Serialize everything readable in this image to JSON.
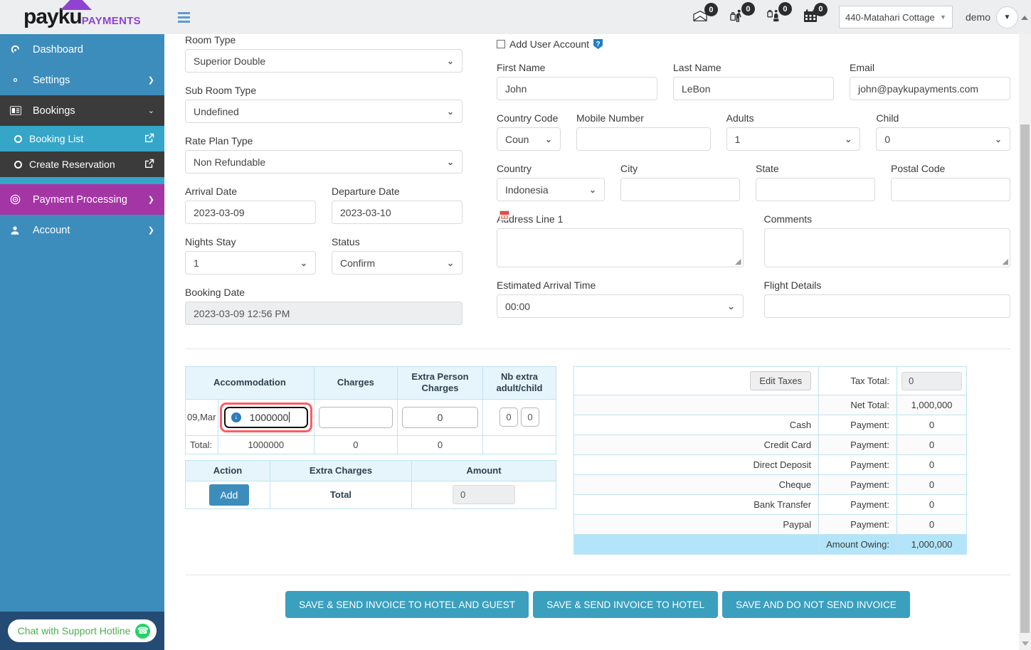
{
  "brand": {
    "name": "payku",
    "suffix": "PAYMENTS"
  },
  "topbar": {
    "notifications": [
      {
        "icon": "envelope-icon",
        "glyph": "✉",
        "count": "0"
      },
      {
        "icon": "arrivals-icon",
        "glyph": "🛄",
        "count": "0"
      },
      {
        "icon": "departures-icon",
        "glyph": "🛎",
        "count": "0"
      },
      {
        "icon": "calendar-icon",
        "glyph": "📅",
        "count": "0"
      }
    ],
    "hotel_selected": "440-Matahari Cottage",
    "user": "demo"
  },
  "sidebar": {
    "items": [
      {
        "label": "Dashboard",
        "icon": "dashboard-icon",
        "glyph": "◔",
        "arrow": "",
        "state": "normal"
      },
      {
        "label": "Settings",
        "icon": "gear-icon",
        "glyph": "⚙",
        "arrow": "❯",
        "state": "normal"
      },
      {
        "label": "Bookings",
        "icon": "bookings-icon",
        "glyph": "▤",
        "arrow": "⌄",
        "state": "open"
      }
    ],
    "sub_items": [
      {
        "label": "Booking List",
        "icon": "circle-icon",
        "ext": "⧉",
        "state": "normal"
      },
      {
        "label": "Create Reservation",
        "icon": "circle-icon",
        "ext": "⧉",
        "state": "current"
      }
    ],
    "items_after": [
      {
        "label": "Payment Processing",
        "icon": "target-icon",
        "glyph": "◎",
        "arrow": "❯",
        "state": "purple"
      },
      {
        "label": "Account",
        "icon": "user-icon",
        "glyph": "👤",
        "arrow": "❯",
        "state": "normal"
      }
    ]
  },
  "form_left": {
    "room_type": {
      "label": "Room Type",
      "value": "Superior Double"
    },
    "sub_room_type": {
      "label": "Sub Room Type",
      "value": "Undefined"
    },
    "rate_plan_type": {
      "label": "Rate Plan Type",
      "value": "Non Refundable"
    },
    "arrival_date": {
      "label": "Arrival Date",
      "value": "2023-03-09"
    },
    "departure_date": {
      "label": "Departure Date",
      "value": "2023-03-10"
    },
    "nights_stay": {
      "label": "Nights Stay",
      "value": "1"
    },
    "status": {
      "label": "Status",
      "value": "Confirm"
    },
    "booking_date": {
      "label": "Booking Date",
      "value": "2023-03-09 12:56 PM"
    }
  },
  "form_right": {
    "add_user_account": {
      "label": "Add User Account",
      "checked": false
    },
    "first_name": {
      "label": "First Name",
      "value": "John"
    },
    "last_name": {
      "label": "Last Name",
      "value": "LeBon"
    },
    "email": {
      "label": "Email",
      "value": "john@paykupayments.com"
    },
    "country_code": {
      "label": "Country Code",
      "value": "Coun"
    },
    "mobile_number": {
      "label": "Mobile Number",
      "value": ""
    },
    "adults": {
      "label": "Adults",
      "value": "1"
    },
    "child": {
      "label": "Child",
      "value": "0"
    },
    "country": {
      "label": "Country",
      "value": "Indonesia"
    },
    "city": {
      "label": "City",
      "value": ""
    },
    "state": {
      "label": "State",
      "value": ""
    },
    "postal_code": {
      "label": "Postal Code",
      "value": ""
    },
    "address_line_1": {
      "label": "Address Line 1",
      "value": ""
    },
    "comments": {
      "label": "Comments",
      "value": ""
    },
    "estimated_arrival_time": {
      "label": "Estimated Arrival Time",
      "value": "00:00"
    },
    "flight_details": {
      "label": "Flight Details",
      "value": ""
    }
  },
  "accommodation_table": {
    "headers": [
      "Accommodation",
      "Charges",
      "Extra Person Charges",
      "Nb extra adult/child"
    ],
    "row": {
      "date_label": "09,Mar",
      "accommodation": "1000000",
      "charges": "",
      "extra_person_charges": "0",
      "nb_extra_adult": "0",
      "nb_extra_child": "0"
    },
    "total_row": {
      "label": "Total:",
      "accommodation": "1000000",
      "charges": "0",
      "extra_person_charges": "0"
    }
  },
  "extra_charges_table": {
    "headers": [
      "Action",
      "Extra Charges",
      "Amount"
    ],
    "add_button": "Add",
    "total_label": "Total",
    "total_amount": "0"
  },
  "payments_table": {
    "edit_taxes_button": "Edit Taxes",
    "rows": [
      {
        "method": "",
        "label": "Tax Total:",
        "value": "0",
        "kind": "input"
      },
      {
        "method": "",
        "label": "Net Total:",
        "value": "1,000,000",
        "kind": "text"
      },
      {
        "method": "Cash",
        "label": "Payment:",
        "value": "0",
        "kind": "text"
      },
      {
        "method": "Credit Card",
        "label": "Payment:",
        "value": "0",
        "kind": "text"
      },
      {
        "method": "Direct Deposit",
        "label": "Payment:",
        "value": "0",
        "kind": "text"
      },
      {
        "method": "Cheque",
        "label": "Payment:",
        "value": "0",
        "kind": "text"
      },
      {
        "method": "Bank Transfer",
        "label": "Payment:",
        "value": "0",
        "kind": "text"
      },
      {
        "method": "Paypal",
        "label": "Payment:",
        "value": "0",
        "kind": "text"
      },
      {
        "method": "",
        "label": "Amount Owing:",
        "value": "1,000,000",
        "kind": "owing"
      }
    ]
  },
  "footer_buttons": [
    "SAVE & SEND INVOICE TO HOTEL AND GUEST",
    "SAVE & SEND INVOICE TO HOTEL",
    "SAVE AND DO NOT SEND INVOICE"
  ],
  "chat_widget": {
    "label": "Chat with Support Hotline",
    "icon": "whatsapp-icon"
  },
  "colors": {
    "sidebar": "#3c8dbc",
    "sidebar_sub": "#35a5c8",
    "active_dark": "#3b3b3b",
    "purple": "#a435a4",
    "accent": "#3aa0bd",
    "focus_red": "#fd5c63",
    "owing_blue": "#b3e5fa"
  }
}
